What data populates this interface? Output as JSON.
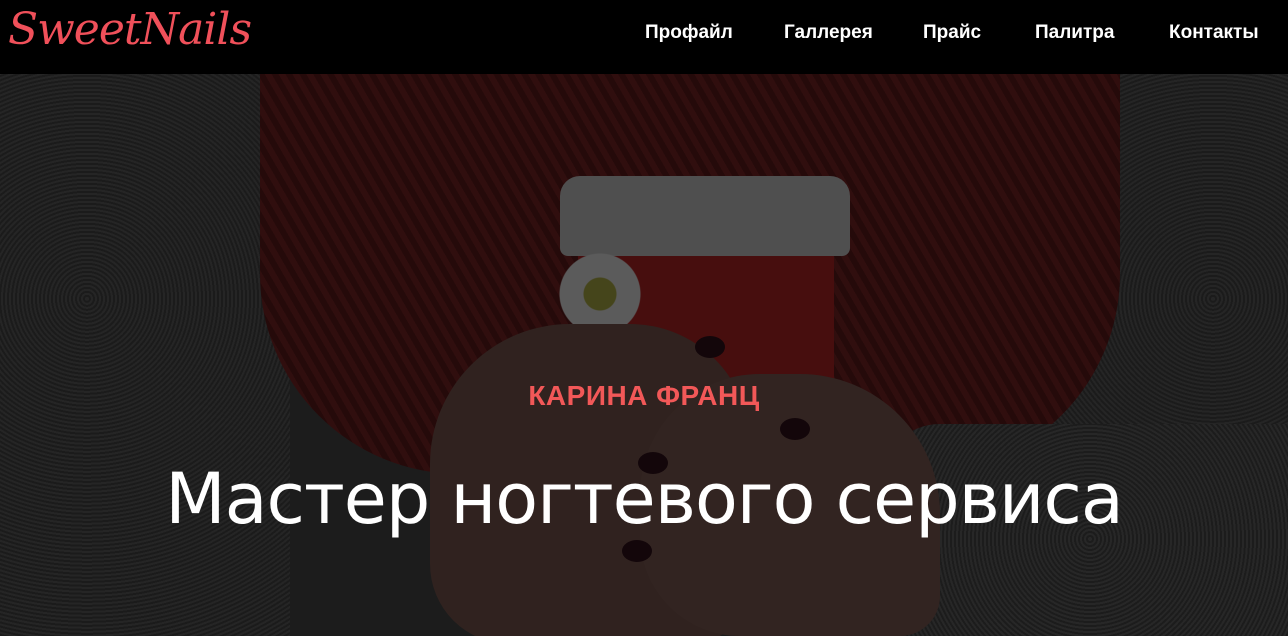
{
  "header": {
    "logo_text": "SweetNails",
    "nav": [
      {
        "label": "Профайл"
      },
      {
        "label": "Галлерея"
      },
      {
        "label": "Прайс"
      },
      {
        "label": "Палитра"
      },
      {
        "label": "Контакты"
      }
    ]
  },
  "hero": {
    "subtitle": "КАРИНА ФРАНЦ",
    "title": "Мастер ногтевого сервиса"
  },
  "colors": {
    "accent": "#f0505a",
    "navbar_bg": "#000000",
    "text_light": "#ffffff"
  }
}
